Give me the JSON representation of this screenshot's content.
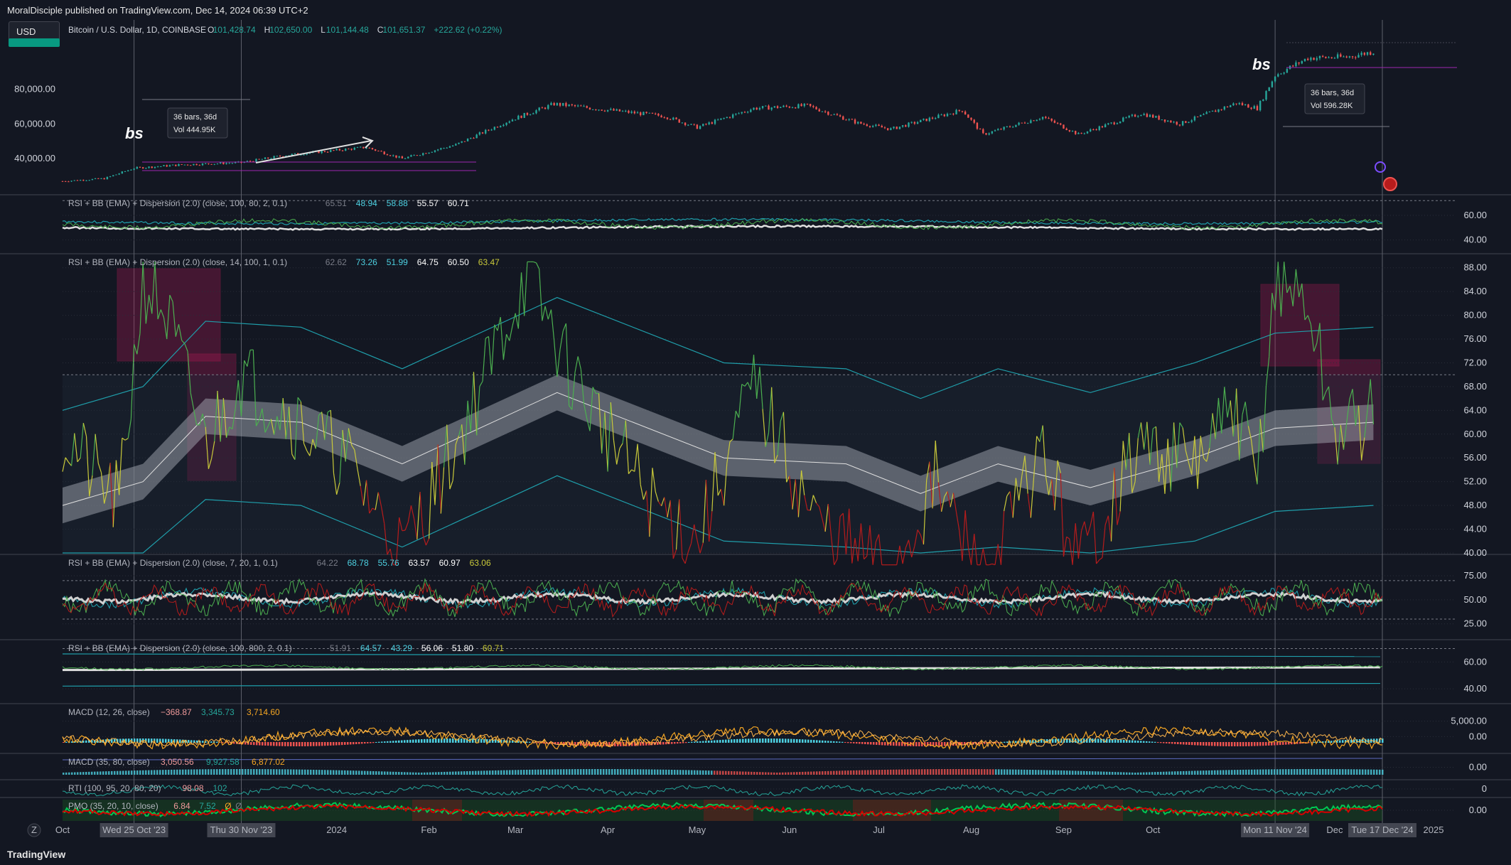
{
  "header": {
    "published": "MoralDisciple published on TradingView.com, Dec 14, 2024 06:39 UTC+2",
    "currency": "USD"
  },
  "footer": {
    "brand": "TradingView",
    "z_button": "Z"
  },
  "colors": {
    "background": "#131722",
    "grid": "#2a2e39",
    "up": "#26a69a",
    "down": "#ef5350",
    "rsi_green": "#4caf50",
    "rsi_red": "#b71c1c",
    "rsi_yellow": "#c9c93a",
    "bb": "#1f9eaa",
    "band": "#9598a1",
    "macd": "#f5a623",
    "signal": "#ff9800",
    "highlight": "#c2185b",
    "purple": "#9c27b0"
  },
  "chart_data": [
    {
      "type": "candlestick",
      "title": "Bitcoin / U.S. Dollar, 1D, COINBASE",
      "ohlc_readout": {
        "o_label": "O",
        "o": "101,428.74",
        "h_label": "H",
        "h": "102,650.00",
        "l_label": "L",
        "l": "101,144.48",
        "c_label": "C",
        "c": "101,651.37",
        "change": "+222.62 (+0.22%)"
      },
      "y_ticks": [
        "80,000.00",
        "60,000.00",
        "40,000.00"
      ],
      "ylim": [
        20000,
        115000
      ],
      "series": [
        {
          "name": "close",
          "x": [
            "2023-10-01",
            "2023-10-15",
            "2023-10-25",
            "2023-11-10",
            "2023-11-30",
            "2023-12-15",
            "2024-01-11",
            "2024-01-23",
            "2024-02-10",
            "2024-02-28",
            "2024-03-14",
            "2024-04-01",
            "2024-04-20",
            "2024-05-01",
            "2024-05-20",
            "2024-06-07",
            "2024-06-24",
            "2024-07-05",
            "2024-07-29",
            "2024-08-05",
            "2024-08-25",
            "2024-09-06",
            "2024-09-27",
            "2024-10-10",
            "2024-10-29",
            "2024-11-05",
            "2024-11-11",
            "2024-11-22",
            "2024-12-05",
            "2024-12-14"
          ],
          "y": [
            27000,
            28500,
            34500,
            36500,
            37700,
            42000,
            46500,
            40000,
            48000,
            62000,
            71500,
            68000,
            64500,
            58000,
            69000,
            70500,
            60500,
            57000,
            68000,
            54000,
            64000,
            54000,
            66000,
            60000,
            72000,
            69000,
            88000,
            98000,
            98500,
            101650
          ]
        }
      ]
    },
    {
      "type": "line",
      "title": "RSI + BB (EMA) + Dispersion (2.0) (close, 100, 80, 2, 0.1)",
      "values_readout": [
        "65.51",
        "48.94",
        "58.88",
        "55.57",
        "60.71"
      ],
      "y_ticks": [
        "60.00",
        "40.00"
      ],
      "ylim": [
        30,
        75
      ]
    },
    {
      "type": "line",
      "title": "RSI + BB (EMA) + Dispersion (2.0) (close, 14, 100, 1, 0.1)",
      "values_readout": [
        "62.62",
        "73.26",
        "51.99",
        "64.75",
        "60.50",
        "63.47"
      ],
      "y_ticks": [
        "88.00",
        "84.00",
        "80.00",
        "76.00",
        "72.00",
        "68.00",
        "64.00",
        "60.00",
        "56.00",
        "52.00",
        "48.00",
        "44.00",
        "40.00"
      ],
      "ylim": [
        40,
        90
      ],
      "levels": [
        70,
        30
      ],
      "series": [
        {
          "name": "RSI",
          "x": [
            "2023-10-01",
            "2023-10-20",
            "2023-10-28",
            "2023-11-05",
            "2023-11-18",
            "2023-11-30",
            "2023-12-10",
            "2024-01-05",
            "2024-01-23",
            "2024-02-10",
            "2024-02-28",
            "2024-03-05",
            "2024-03-20",
            "2024-04-15",
            "2024-05-01",
            "2024-05-20",
            "2024-06-10",
            "2024-07-05",
            "2024-07-20",
            "2024-08-05",
            "2024-08-25",
            "2024-09-06",
            "2024-09-27",
            "2024-10-15",
            "2024-10-29",
            "2024-11-05",
            "2024-11-11",
            "2024-11-22",
            "2024-12-01",
            "2024-12-14"
          ],
          "y": [
            60,
            48,
            86,
            80,
            58,
            70,
            66,
            55,
            40,
            58,
            80,
            87,
            70,
            49,
            42,
            68,
            45,
            36,
            52,
            35,
            57,
            38,
            58,
            55,
            64,
            52,
            86,
            82,
            60,
            63
          ]
        },
        {
          "name": "EMA",
          "x": [
            "2023-10-01",
            "2023-10-28",
            "2023-11-18",
            "2023-12-20",
            "2024-01-23",
            "2024-03-15",
            "2024-05-10",
            "2024-06-20",
            "2024-07-15",
            "2024-08-10",
            "2024-09-10",
            "2024-10-15",
            "2024-11-11",
            "2024-12-14"
          ],
          "y": [
            48,
            52,
            63,
            62,
            55,
            67,
            56,
            55,
            50,
            55,
            51,
            56,
            61,
            62
          ]
        }
      ]
    },
    {
      "type": "line",
      "title": "RSI + BB (EMA) + Dispersion (2.0) (close, 7, 20, 1, 0.1)",
      "values_readout": [
        "64.22",
        "68.78",
        "55.76",
        "63.57",
        "60.97",
        "63.06"
      ],
      "y_ticks": [
        "75.00",
        "50.00",
        "25.00"
      ],
      "ylim": [
        10,
        95
      ]
    },
    {
      "type": "line",
      "title": "RSI + BB (EMA) + Dispersion (2.0) (close, 100, 800, 2, 0.1)",
      "values_readout": [
        "51.91",
        "64.57",
        "43.29",
        "56.06",
        "51.80",
        "60.71"
      ],
      "y_ticks": [
        "60.00",
        "40.00"
      ],
      "ylim": [
        30,
        75
      ]
    },
    {
      "type": "line",
      "title": "MACD (12, 26, close)",
      "values_readout": [
        "−368.87",
        "3,345.73",
        "3,714.60"
      ],
      "y_ticks": [
        "5,000.00",
        "0.00"
      ]
    },
    {
      "type": "line",
      "title": "MACD (35, 80, close)",
      "values_readout": [
        "3,050.56",
        "9,927.58",
        "6,877.02"
      ],
      "y_ticks": [
        "0.00"
      ]
    },
    {
      "type": "area",
      "title": "RTI (100, 95, 20, 80, 20)",
      "values_readout": [
        "98.08",
        "102"
      ],
      "y_ticks": [
        "0"
      ]
    },
    {
      "type": "line",
      "title": "PMO (35, 20, 10, close)",
      "values_readout": [
        "6.84",
        "7.52",
        "Ø",
        "Ø"
      ],
      "y_ticks": [
        "0.00"
      ]
    }
  ],
  "annotations": {
    "left": {
      "tag": "bs",
      "bars": "36 bars, 36d",
      "vol": "Vol 444.95K"
    },
    "right": {
      "tag": "bs",
      "bars": "36 bars, 36d",
      "vol": "Vol 596.28K"
    }
  },
  "time_axis": {
    "labels": [
      {
        "text": "Oct",
        "date": "2023-10-01"
      },
      {
        "text": "2024",
        "date": "2024-01-01"
      },
      {
        "text": "Feb",
        "date": "2024-02-01"
      },
      {
        "text": "Mar",
        "date": "2024-03-01"
      },
      {
        "text": "Apr",
        "date": "2024-04-01"
      },
      {
        "text": "May",
        "date": "2024-05-01"
      },
      {
        "text": "Jun",
        "date": "2024-06-01"
      },
      {
        "text": "Jul",
        "date": "2024-07-01"
      },
      {
        "text": "Aug",
        "date": "2024-08-01"
      },
      {
        "text": "Sep",
        "date": "2024-09-01"
      },
      {
        "text": "Oct",
        "date": "2024-10-01"
      },
      {
        "text": "Dec",
        "date": "2024-12-01"
      },
      {
        "text": "2025",
        "date": "2025-01-01"
      }
    ],
    "cursor_labels": [
      {
        "text": "Wed 25 Oct '23",
        "date": "2023-10-25"
      },
      {
        "text": "Thu 30 Nov '23",
        "date": "2023-11-30"
      },
      {
        "text": "Mon 11 Nov '24",
        "date": "2024-11-11"
      },
      {
        "text": "Tue 17 Dec '24",
        "date": "2024-12-17"
      }
    ]
  }
}
